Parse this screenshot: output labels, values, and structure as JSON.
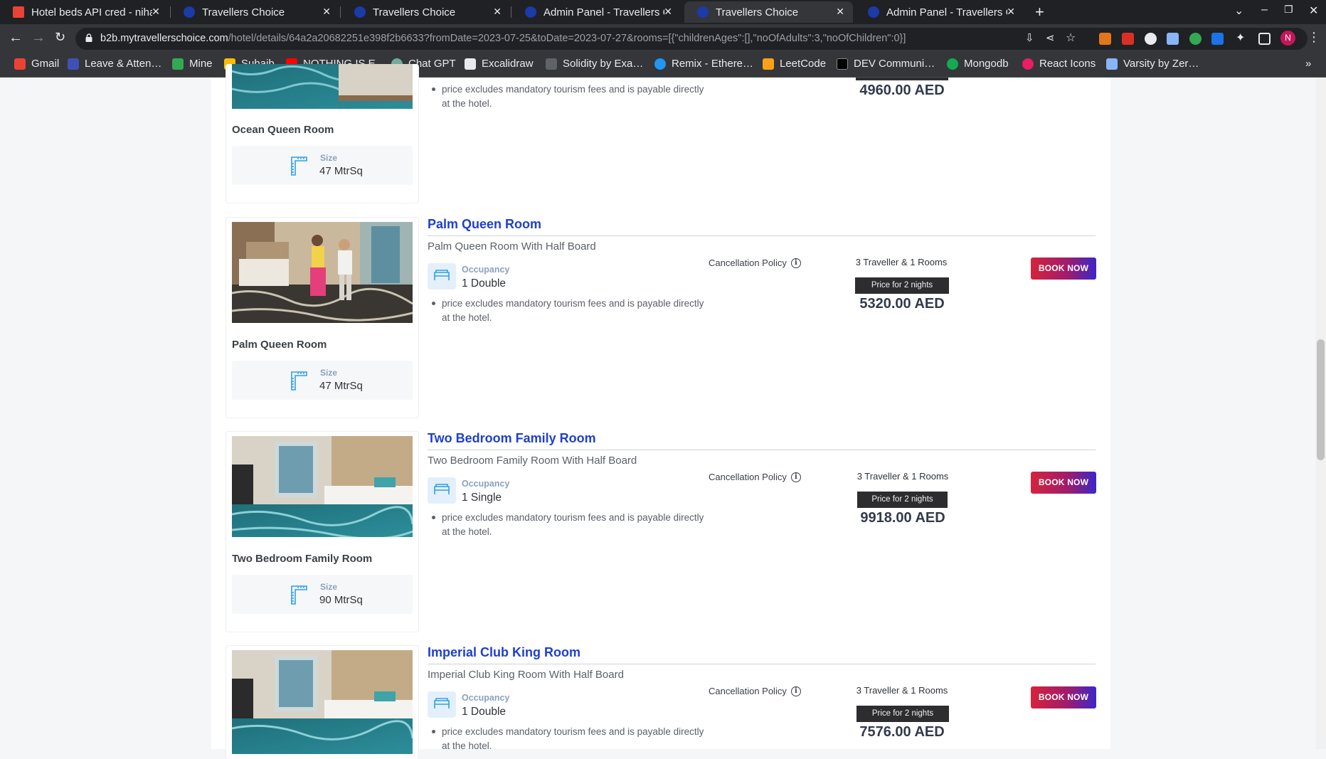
{
  "browser": {
    "tabs": [
      {
        "title": "Hotel beds API cred - niha",
        "favicon": "gmail-icon",
        "color": "#ea4335"
      },
      {
        "title": "Travellers Choice",
        "favicon": "travellers-choice-icon",
        "color": "#1a3ba8"
      },
      {
        "title": "Travellers Choice",
        "favicon": "travellers-choice-icon",
        "color": "#1a3ba8"
      },
      {
        "title": "Admin Panel - Travellers C",
        "favicon": "travellers-choice-icon",
        "color": "#1a3ba8"
      },
      {
        "title": "Travellers Choice",
        "favicon": "travellers-choice-icon",
        "color": "#1a3ba8",
        "active": true
      },
      {
        "title": "Admin Panel - Travellers C",
        "favicon": "travellers-choice-icon",
        "color": "#1a3ba8"
      }
    ],
    "url_host": "b2b.mytravellerschoice.com",
    "url_path": "/hotel/details/64a2a20682251e398f2b6633?fromDate=2023-07-25&toDate=2023-07-27&rooms=[{\"childrenAges\":[],\"noOfAdults\":3,\"noOfChildren\":0}]",
    "bookmarks": [
      {
        "label": "Gmail",
        "icon": "gmail-icon"
      },
      {
        "label": "Leave & Atten…",
        "icon": "kredily-icon"
      },
      {
        "label": "Mine",
        "icon": "drive-icon"
      },
      {
        "label": "Suhaib",
        "icon": "drive-icon"
      },
      {
        "label": "NOTHING IS E…",
        "icon": "youtube-icon"
      },
      {
        "label": "Chat GPT",
        "icon": "openai-icon"
      },
      {
        "label": "Excalidraw",
        "icon": "excalidraw-icon"
      },
      {
        "label": "Solidity by Exa…",
        "icon": "solidity-icon"
      },
      {
        "label": "Remix - Ethere…",
        "icon": "remix-icon"
      },
      {
        "label": "LeetCode",
        "icon": "leetcode-icon"
      },
      {
        "label": "DEV Communi…",
        "icon": "dev-icon"
      },
      {
        "label": "Mongodb",
        "icon": "mongodb-icon"
      },
      {
        "label": "React Icons",
        "icon": "react-icons-icon"
      },
      {
        "label": "Varsity by Zer…",
        "icon": "varsity-icon"
      }
    ],
    "profile_initial": "N"
  },
  "labels": {
    "size": "Size",
    "occupancy": "Occupancy",
    "note": "price excludes mandatory tourism fees and is payable directly at the hotel.",
    "cancellation": "Cancellation Policy",
    "price_for": "Price for 2 nights",
    "book_now": "BOOK NOW"
  },
  "rooms": [
    {
      "name": "Ocean Queen Room",
      "size": "47 MtrSq",
      "price": "4960.00 AED",
      "partial": true
    },
    {
      "name": "Palm Queen Room",
      "title": "Palm Queen Room",
      "subtitle": "Palm Queen Room With Half Board",
      "occupancy": "1 Double",
      "travellers": "3 Traveller & 1 Rooms",
      "size": "47 MtrSq",
      "price": "5320.00 AED"
    },
    {
      "name": "Two Bedroom Family Room",
      "title": "Two Bedroom Family Room",
      "subtitle": "Two Bedroom Family Room With Half Board",
      "occupancy": "1 Single",
      "travellers": "3 Traveller & 1 Rooms",
      "size": "90 MtrSq",
      "price": "9918.00 AED"
    },
    {
      "name": "Imperial Club King Room",
      "title": "Imperial Club King Room",
      "subtitle": "Imperial Club King Room With Half Board",
      "occupancy": "1 Double",
      "travellers": "3 Traveller & 1 Rooms",
      "size": "",
      "price": "7576.00 AED"
    }
  ]
}
